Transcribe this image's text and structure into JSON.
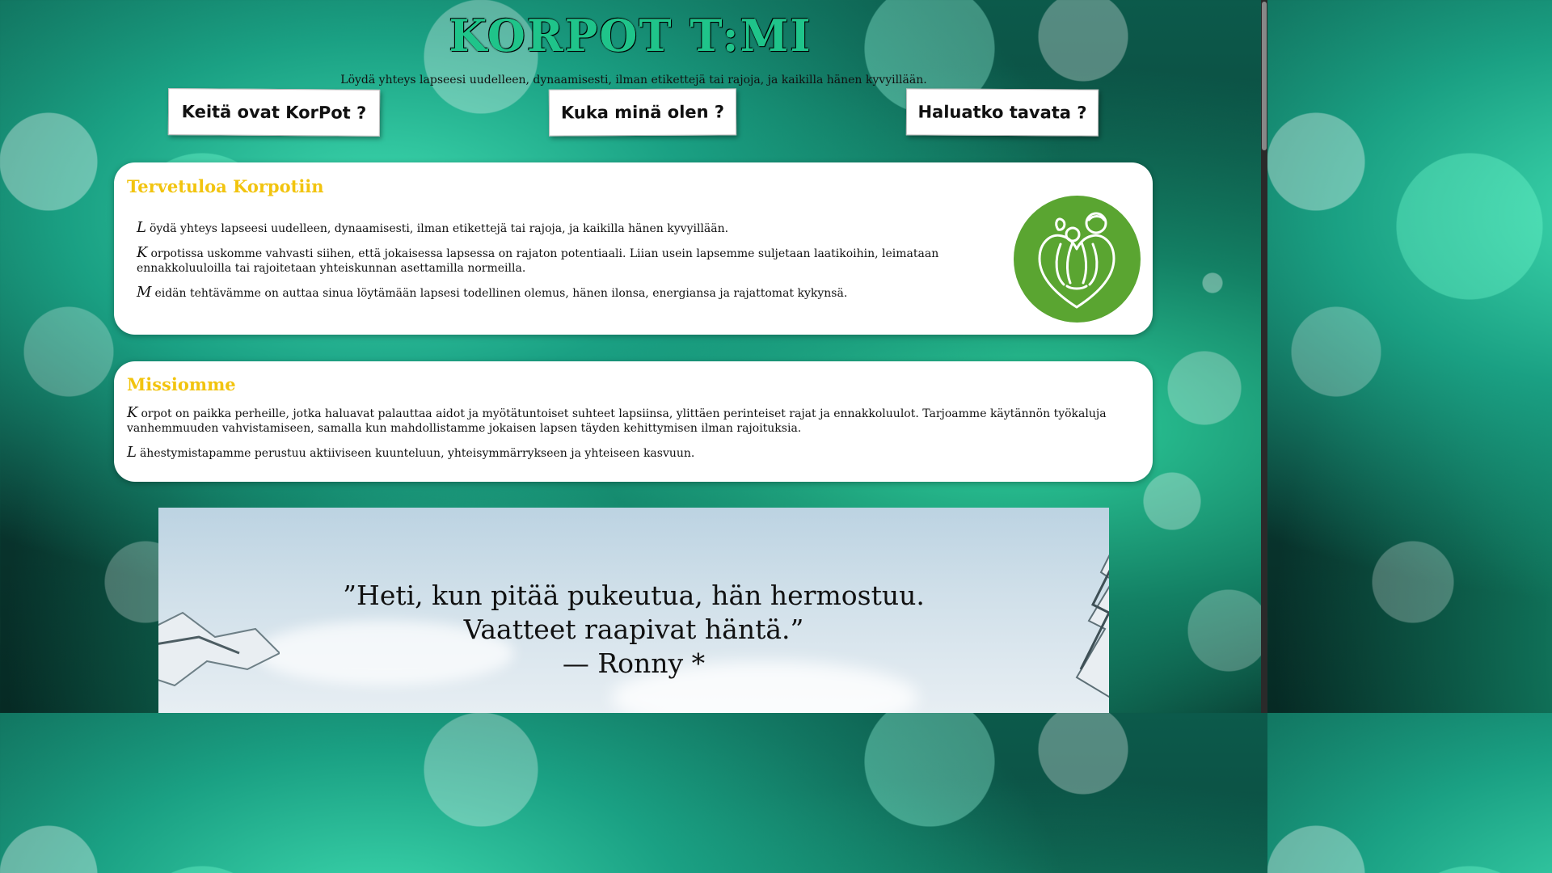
{
  "header": {
    "site_title": "KORPOT T:MI",
    "tagline": "Löydä yhteys lapseesi uudelleen, dynaamisesti, ilman etikettejä tai rajoja, ja kaikilla hänen kyvyillään."
  },
  "nav": {
    "items": [
      {
        "label": "Keitä ovat KorPot ?"
      },
      {
        "label": "Kuka minä olen ?"
      },
      {
        "label": "Haluatko tavata ?"
      }
    ]
  },
  "welcome": {
    "title": "Tervetuloa Korpotiin",
    "paragraphs": [
      {
        "initial": "L",
        "text": "öydä yhteys lapseesi uudelleen, dynaamisesti, ilman etikettejä tai rajoja, ja kaikilla hänen kyvyillään."
      },
      {
        "initial": "K",
        "text": "orpotissa uskomme vahvasti siihen, että jokaisessa lapsessa on rajaton potentiaali. Liian usein lapsemme suljetaan laatikoihin, leimataan ennakkoluuloilla tai rajoitetaan yhteiskunnan asettamilla normeilla."
      },
      {
        "initial": "M",
        "text": "eidän tehtävämme on auttaa sinua löytämään lapsesi todellinen olemus, hänen ilonsa, energiansa ja rajattomat kykynsä."
      }
    ],
    "logo_color": "#5aa531"
  },
  "mission": {
    "title": "Missiomme",
    "paragraphs": [
      {
        "initial": "K",
        "text": "orpot on paikka perheille, jotka haluavat palauttaa aidot ja myötätuntoiset suhteet lapsiinsa, ylittäen perinteiset rajat ja ennakkoluulot. Tarjoamme käytännön työkaluja vanhemmuuden vahvistamiseen, samalla kun mahdollistamme jokaisen lapsen täyden kehittymisen ilman rajoituksia."
      },
      {
        "initial": "L",
        "text": "ähestymistapamme perustuu aktiiviseen kuunteluun, yhteisymmärrykseen ja yhteiseen kasvuun."
      }
    ]
  },
  "quote": {
    "line1": "”Heti, kun pitää pukeutua, hän hermostuu.",
    "line2": "Vaatteet raapivat häntä.”",
    "line3": "— Ronny *"
  },
  "colors": {
    "title_green": "#1fc48a",
    "heading_yellow": "#f2c40f",
    "logo_green": "#5aa531"
  }
}
